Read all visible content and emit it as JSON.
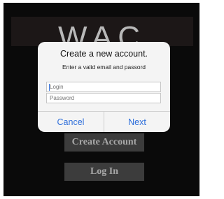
{
  "background": {
    "logo_text": "WAC",
    "create_account_label": "Create Account",
    "login_label": "Log In"
  },
  "dialog": {
    "title": "Create a new account.",
    "message": "Enter a valid email and passord",
    "login_placeholder": "Login",
    "password_placeholder": "Password",
    "cancel_label": "Cancel",
    "next_label": "Next"
  },
  "colors": {
    "accent": "#2f6fdb",
    "app_background": "#0a0a0a",
    "app_button": "#3c3c3c"
  }
}
